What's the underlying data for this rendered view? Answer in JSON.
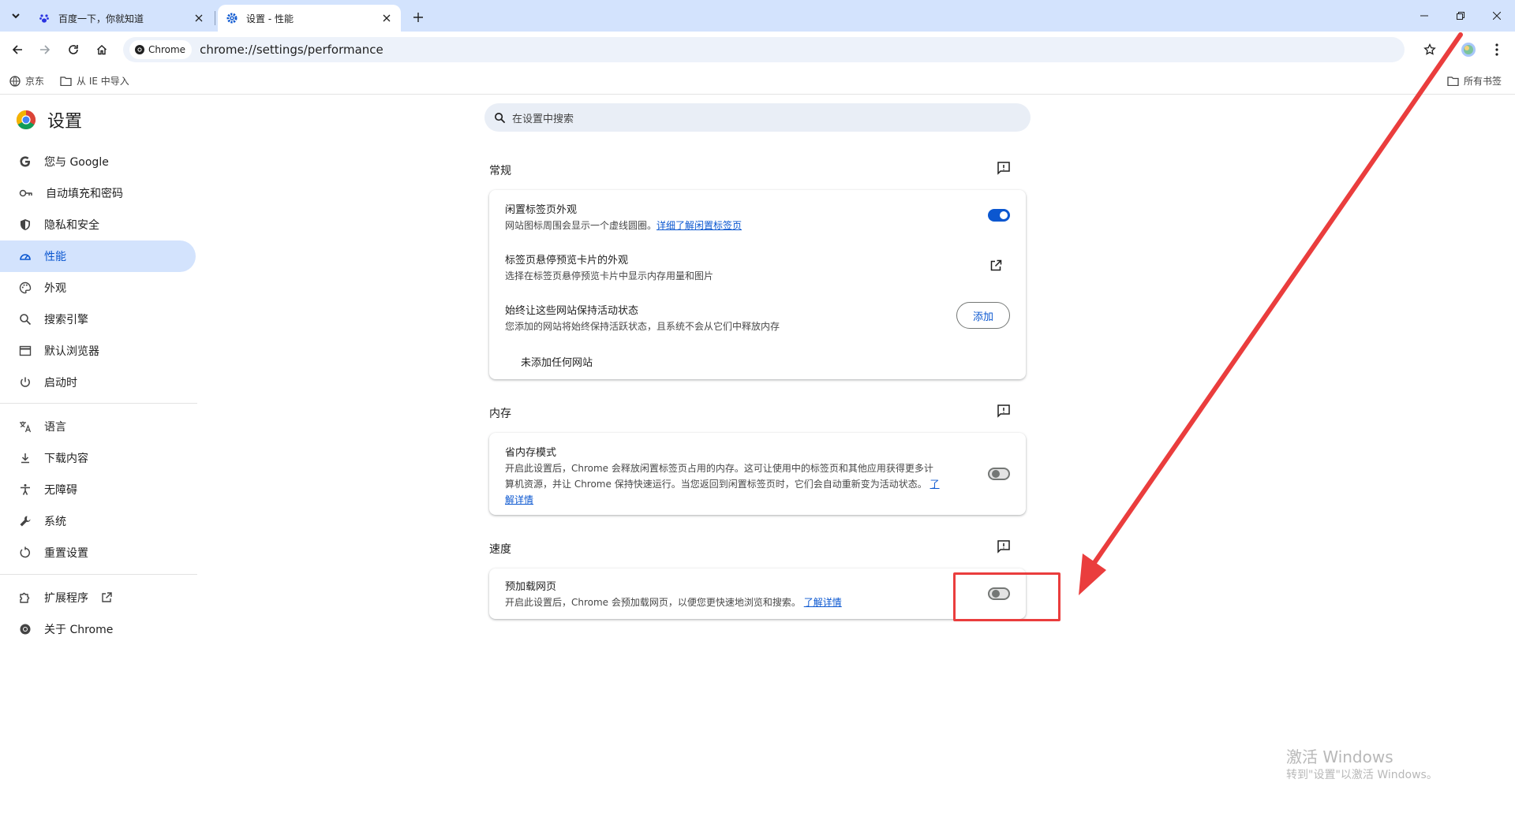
{
  "browser": {
    "tabs": [
      {
        "title": "百度一下，你就知道",
        "active": false
      },
      {
        "title": "设置 - 性能",
        "active": true
      }
    ],
    "omnibox_chip": "Chrome",
    "url": "chrome://settings/performance",
    "bookmarks": [
      "京东",
      "从 IE 中导入"
    ],
    "all_bookmarks": "所有书签"
  },
  "sidebar": {
    "title": "设置",
    "items": [
      {
        "label": "您与 Google",
        "icon": "google-g-icon"
      },
      {
        "label": "自动填充和密码",
        "icon": "key-icon"
      },
      {
        "label": "隐私和安全",
        "icon": "shield-icon"
      },
      {
        "label": "性能",
        "icon": "speedometer-icon",
        "active": true
      },
      {
        "label": "外观",
        "icon": "palette-icon"
      },
      {
        "label": "搜索引擎",
        "icon": "search-icon"
      },
      {
        "label": "默认浏览器",
        "icon": "browser-window-icon"
      },
      {
        "label": "启动时",
        "icon": "power-icon"
      },
      {
        "label": "语言",
        "icon": "translate-icon"
      },
      {
        "label": "下载内容",
        "icon": "download-icon"
      },
      {
        "label": "无障碍",
        "icon": "accessibility-icon"
      },
      {
        "label": "系统",
        "icon": "wrench-icon"
      },
      {
        "label": "重置设置",
        "icon": "reset-icon"
      },
      {
        "label": "扩展程序",
        "icon": "puzzle-icon"
      },
      {
        "label": "关于 Chrome",
        "icon": "chrome-icon"
      }
    ]
  },
  "search": {
    "placeholder": "在设置中搜索"
  },
  "sections": {
    "general": {
      "title": "常规",
      "rows": [
        {
          "label": "闲置标签页外观",
          "sub": "网站图标周围会显示一个虚线圆圈。",
          "link": "详细了解闲置标签页",
          "toggle": true
        },
        {
          "label": "标签页悬停预览卡片的外观",
          "sub": "选择在标签页悬停预览卡片中显示内存用量和图片"
        },
        {
          "label": "始终让这些网站保持活动状态",
          "sub": "您添加的网站将始终保持活跃状态，且系统不会从它们中释放内存",
          "button": "添加"
        }
      ],
      "empty": "未添加任何网站"
    },
    "memory": {
      "title": "内存",
      "label": "省内存模式",
      "sub1": "开启此设置后，Chrome 会释放闲置标签页占用的内存。这可让使用中的标签页和其他应用获得更多计",
      "sub2": "算机资源，并让 Chrome 保持快速运行。当您返回到闲置标签页时，它们会自动重新变为活动状态。",
      "link1": "了",
      "link2": "解详情",
      "toggle": false
    },
    "speed": {
      "title": "速度",
      "label": "预加载网页",
      "sub": "开启此设置后，Chrome 会预加载网页，以便您更快速地浏览和搜索。",
      "link": "了解详情",
      "toggle": false
    }
  },
  "watermark": {
    "line1": "激活 Windows",
    "line2": "转到\"设置\"以激活 Windows。"
  },
  "colors": {
    "accent": "#0b57d0",
    "annotation": "#ea3d3d"
  }
}
